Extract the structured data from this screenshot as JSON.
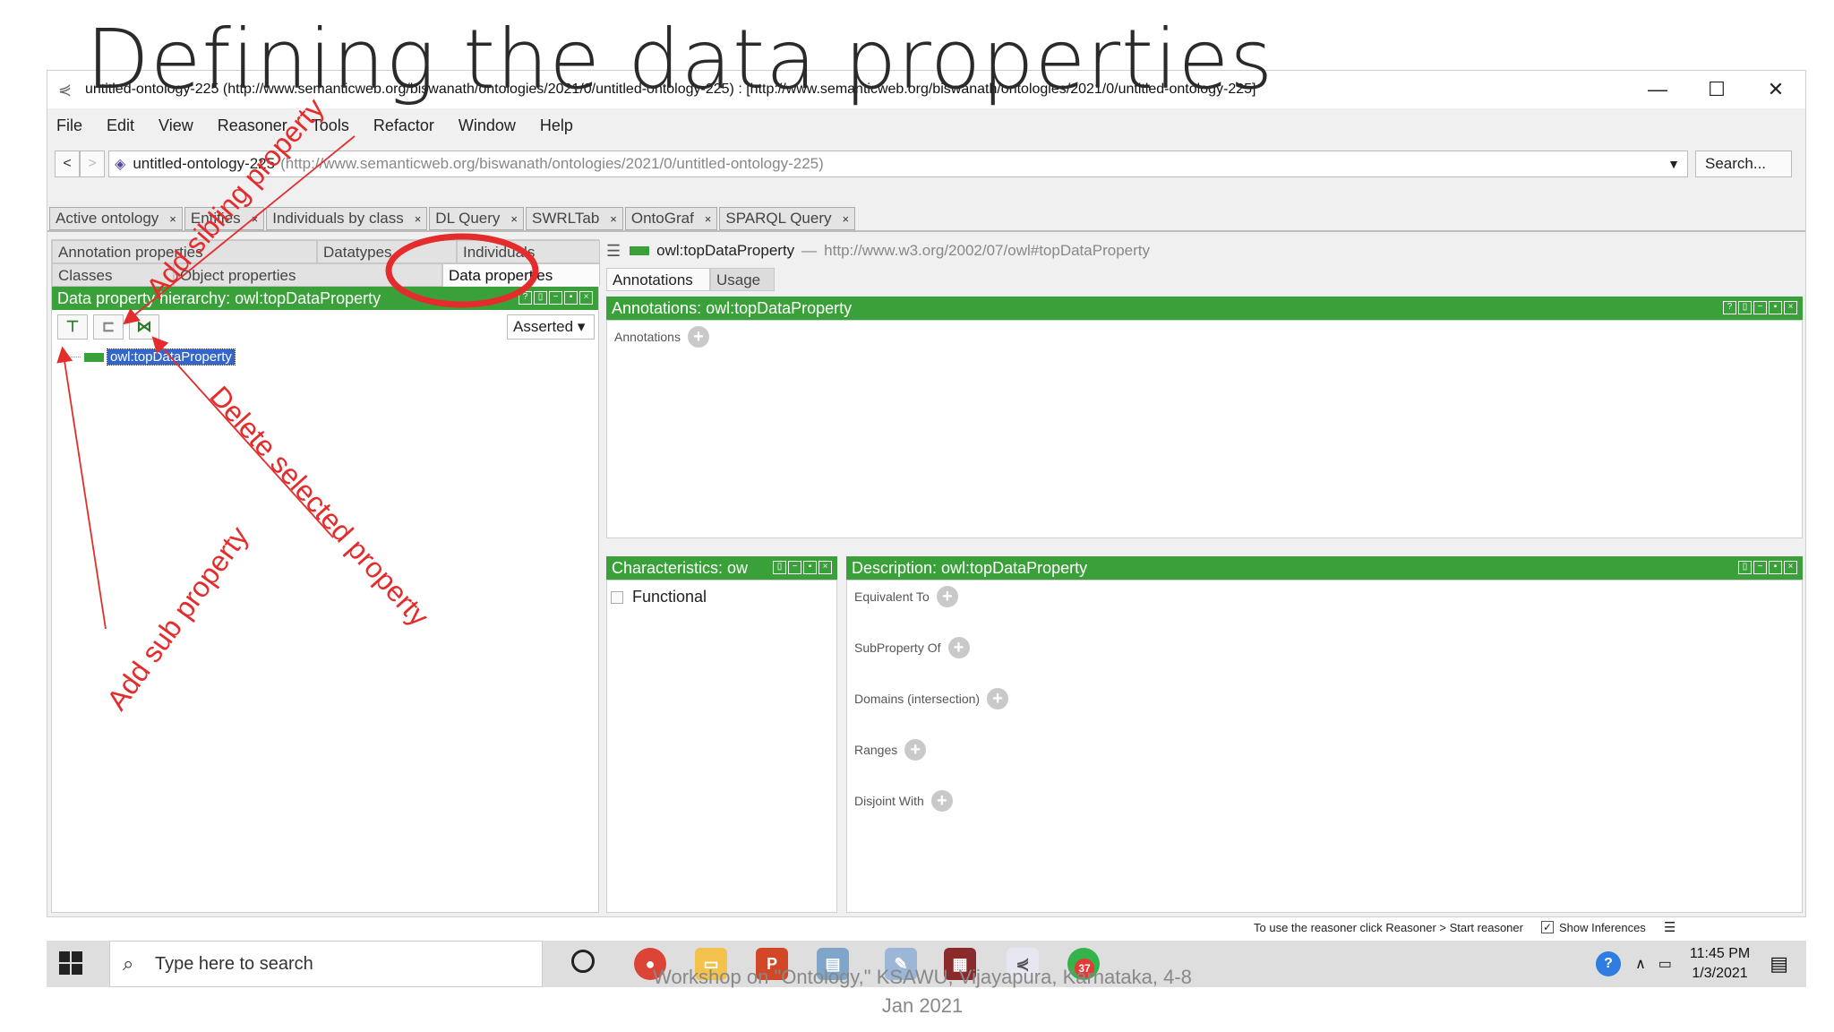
{
  "slide": {
    "title": "Defining the data properties",
    "footer_line1": "Workshop on \"Ontology,\" KSAWU, Vijayapura, Karnataka, 4-8",
    "footer_line2": "Jan 2021"
  },
  "window": {
    "title": "untitled-ontology-225 (http://www.semanticweb.org/biswanath/ontologies/2021/0/untitled-ontology-225) : [http://www.semanticweb.org/biswanath/ontologies/2021/0/untitled-ontology-225]",
    "minimize": "—",
    "maximize": "☐",
    "close": "✕"
  },
  "menu": [
    "File",
    "Edit",
    "View",
    "Reasoner",
    "Tools",
    "Refactor",
    "Window",
    "Help"
  ],
  "nav": {
    "back": "<",
    "forward": ">",
    "ontology_name": "untitled-ontology-225",
    "ontology_uri": "(http://www.semanticweb.org/biswanath/ontologies/2021/0/untitled-ontology-225)",
    "search_label": "Search..."
  },
  "tabs": [
    "Active ontology",
    "Entities",
    "Individuals by class",
    "DL Query",
    "SWRLTab",
    "OntoGraf",
    "SPARQL Query"
  ],
  "tab_close": "×",
  "left": {
    "view_tabs_row1": [
      "Annotation properties",
      "Datatypes",
      "Individuals"
    ],
    "view_tabs_row2": [
      "Classes",
      "Object properties",
      "Data properties"
    ],
    "hierarchy_title": "Data property hierarchy: owl:topDataProperty",
    "asserted_label": "Asserted",
    "tree_root": "owl:topDataProperty"
  },
  "right": {
    "entity_name": "owl:topDataProperty",
    "entity_sep": "—",
    "entity_uri": "http://www.w3.org/2002/07/owl#topDataProperty",
    "subtabs": [
      "Annotations",
      "Usage"
    ],
    "annotations_title": "Annotations: owl:topDataProperty",
    "annotations_label": "Annotations",
    "characteristics_title": "Characteristics: ow",
    "functional_label": "Functional",
    "description_title": "Description: owl:topDataProperty",
    "description_items": [
      "Equivalent To",
      "SubProperty Of",
      "Domains (intersection)",
      "Ranges",
      "Disjoint With"
    ]
  },
  "status": {
    "reasoner_hint": "To use the reasoner click Reasoner > Start reasoner",
    "show_inferences": "Show Inferences"
  },
  "taskbar": {
    "search_placeholder": "Type here to search",
    "time": "11:45 PM",
    "date": "1/3/2021",
    "badge": "37"
  },
  "annotations": {
    "add_sibling": "Add sibling property",
    "delete_selected": "Delete selected property",
    "add_sub": "Add sub property"
  },
  "colors": {
    "panel_green": "#3aa13a",
    "annotation_red": "#e52c2c",
    "selection_blue": "#3366cc"
  }
}
